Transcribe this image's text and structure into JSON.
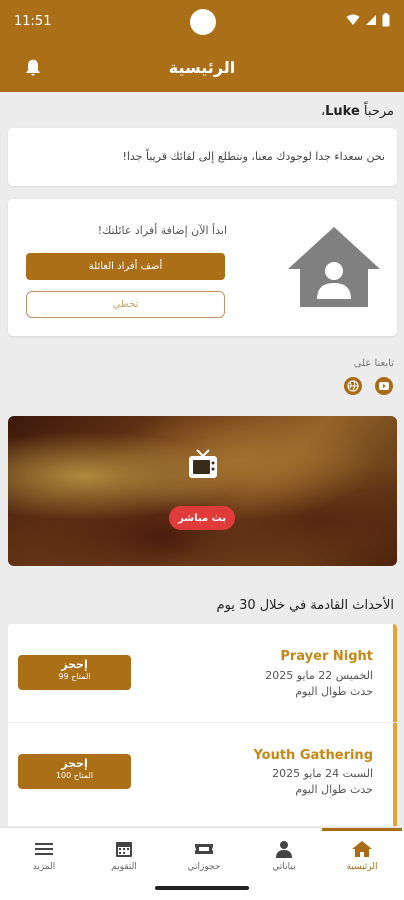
{
  "status_bar": {
    "time": "11:51"
  },
  "header": {
    "title": "الرئيسية",
    "notification_icon": "bell-icon"
  },
  "greeting": {
    "prefix": "مرحباً ",
    "name": "Luke",
    "suffix": "،"
  },
  "welcome": {
    "message": "نحن سعداء جدا لوجودك معنا، ونتطلع إلى لقائك قريباً جدا!"
  },
  "family": {
    "prompt": "ابدأ الآن إضافة أفراد عائلتك!",
    "add_button": "أضف أفراد العائلة",
    "skip_button": "تخطي",
    "image_icon": "house-user-icon"
  },
  "social": {
    "label": "تابعنا على",
    "items": [
      "youtube-icon",
      "globe-icon"
    ]
  },
  "live": {
    "label": "بث مباشر",
    "icon": "tv-icon"
  },
  "events": {
    "heading": "الأحداث القادمة في خلال 30 يوم",
    "items": [
      {
        "title": "Prayer Night",
        "date": "الخميس 22 مايو 2025",
        "time": "حدث طوال اليوم",
        "book_label": "إحجز",
        "availability": "99 المتاح"
      },
      {
        "title": "Youth Gathering",
        "date": "السبت 24 مايو 2025",
        "time": "حدث طوال اليوم",
        "book_label": "إحجز",
        "availability": "100 المتاح"
      }
    ]
  },
  "nav": {
    "items": [
      {
        "label": "المزيد",
        "icon": "menu-icon"
      },
      {
        "label": "التقويم",
        "icon": "calendar-icon"
      },
      {
        "label": "حجوزاتي",
        "icon": "ticket-icon"
      },
      {
        "label": "بياناتي",
        "icon": "person-icon"
      },
      {
        "label": "الرئيسية",
        "icon": "home-icon"
      }
    ],
    "active": "الرئيسية"
  },
  "colors": {
    "primary": "#ab6f17",
    "accent": "#e7a332",
    "live": "#e13a3a",
    "background": "#ececec"
  }
}
